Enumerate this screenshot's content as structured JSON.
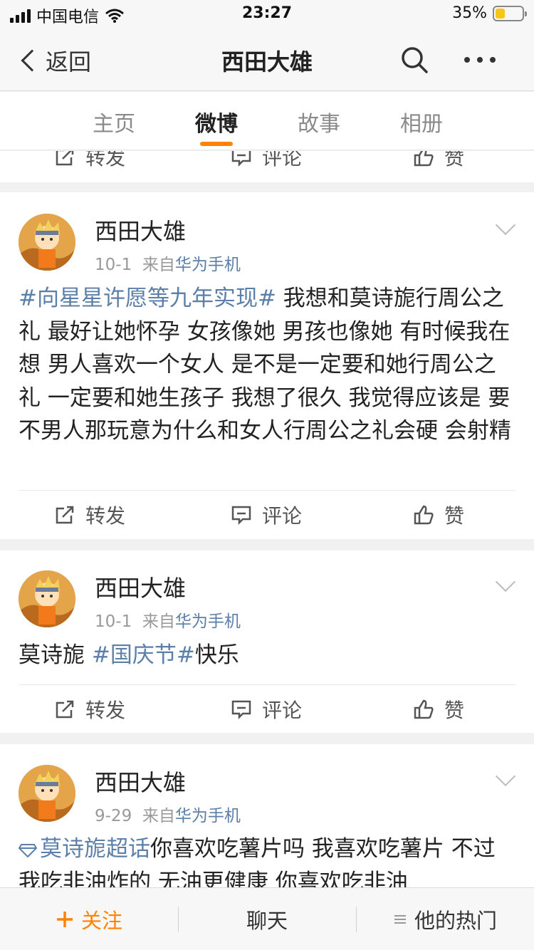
{
  "status": {
    "carrier": "中国电信",
    "time": "23:27",
    "battery": "35%"
  },
  "nav": {
    "back_label": "返回",
    "title": "西田大雄"
  },
  "tabs": [
    {
      "label": "主页"
    },
    {
      "label": "微博"
    },
    {
      "label": "故事"
    },
    {
      "label": "相册"
    }
  ],
  "actions": {
    "repost": "转发",
    "comment": "评论",
    "like": "赞"
  },
  "posts": [
    {
      "user": "西田大雄",
      "date": "10-1",
      "source_prefix": "来自",
      "source": "华为手机",
      "topic": "#向星星许愿等九年实现#",
      "text": " 我想和莫诗旎行周公之礼 最好让她怀孕 女孩像她 男孩也像她 有时候我在想 男人喜欢一个女人 是不是一定要和她行周公之礼 一定要和她生孩子 我想了很久 我觉得应该是 要不男人那玩意为什么和女人行周公之礼会硬 会射精"
    },
    {
      "user": "西田大雄",
      "date": "10-1",
      "source_prefix": "来自",
      "source": "华为手机",
      "text_before": "莫诗旎 ",
      "topic": "#国庆节#",
      "text_after": "快乐"
    },
    {
      "user": "西田大雄",
      "date": "9-29",
      "source_prefix": "来自",
      "source": "华为手机",
      "topic": "莫诗旎超话",
      "text": "你喜欢吃薯片吗 我喜欢吃薯片 不过我吃非油炸的 无油更健康 你喜欢吃非油"
    }
  ],
  "bottom": {
    "follow": "关注",
    "chat": "聊天",
    "hot": "他的热门"
  },
  "colors": {
    "accent": "#ff8200",
    "link": "#5b7fa8"
  }
}
